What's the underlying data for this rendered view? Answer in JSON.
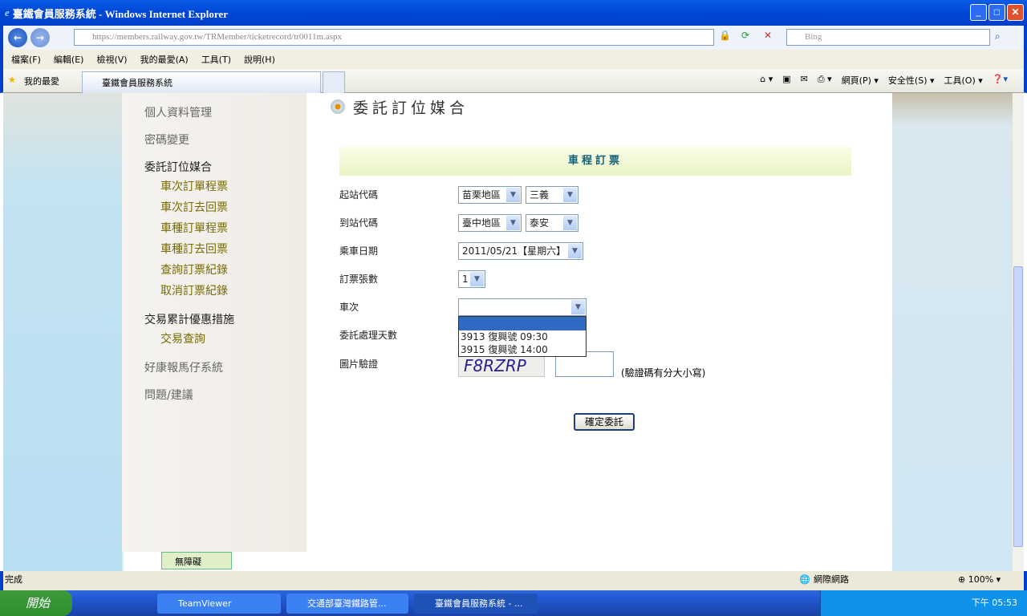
{
  "window": {
    "title": "臺鐵會員服務系統 - Windows Internet Explorer"
  },
  "address": {
    "url": "https://members.railway.gov.tw/TRMember/ticketrecord/tr0011m.aspx",
    "search_placeholder": "Bing"
  },
  "menu": [
    "檔案(F)",
    "編輯(E)",
    "檢視(V)",
    "我的最愛(A)",
    "工具(T)",
    "說明(H)"
  ],
  "favorites": {
    "label": "我的最愛",
    "tab": "臺鐵會員服務系統"
  },
  "commands": [
    "網頁(P) ▾",
    "安全性(S) ▾",
    "工具(O) ▾"
  ],
  "sidebar": {
    "items": [
      {
        "label": "個人資料管理"
      },
      {
        "label": "密碼變更"
      },
      {
        "label": "委託訂位媒合"
      },
      {
        "label": "車次訂單程票"
      },
      {
        "label": "車次訂去回票"
      },
      {
        "label": "車種訂單程票"
      },
      {
        "label": "車種訂去回票"
      },
      {
        "label": "查詢訂票紀錄"
      },
      {
        "label": "取消訂票紀錄"
      },
      {
        "label": "交易累計優惠措施"
      },
      {
        "label": "交易查詢"
      },
      {
        "label": "好康報馬仔系統"
      },
      {
        "label": "問題/建議"
      }
    ],
    "accessibility": "無障礙"
  },
  "main": {
    "title": "委託訂位媒合",
    "panel_title": "車程訂票",
    "form": {
      "from_label": "起站代碼",
      "from_region": "苗栗地區",
      "from_station": "三義",
      "to_label": "到站代碼",
      "to_region": "臺中地區",
      "to_station": "泰安",
      "date_label": "乘車日期",
      "date": "2011/05/21【星期六】",
      "qty_label": "訂票張數",
      "qty": "1",
      "train_label": "車次",
      "train_options": [
        "",
        "3913  復興號  09:30",
        "3915  復興號  14:00"
      ],
      "days_label": "委託處理天數",
      "captcha_label": "圖片驗證",
      "captcha": "F8RZRP",
      "captcha_hint": "(驗證碼有分大小寫)",
      "submit": "確定委託"
    }
  },
  "status": {
    "text": "完成",
    "zone": "網際網路",
    "zoom": "100%"
  },
  "taskbar": {
    "start": "開始",
    "tasks": [
      "TeamViewer",
      "交通部臺灣鐵路管...",
      "臺鐵會員服務系統 - ..."
    ],
    "clock": "下午 05:53"
  }
}
